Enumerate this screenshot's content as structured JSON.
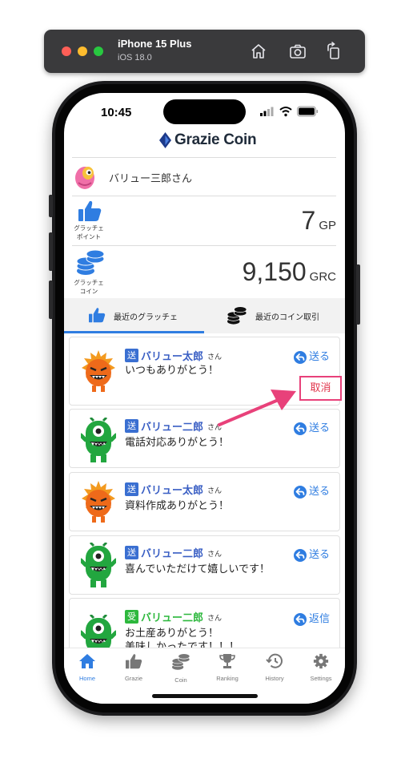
{
  "simulator": {
    "device": "iPhone 15 Plus",
    "os": "iOS 18.0",
    "icons": [
      "home-icon",
      "screenshot-icon",
      "rotate-icon"
    ]
  },
  "status_bar": {
    "time": "10:45"
  },
  "app": {
    "logo_text": "Grazie Coin"
  },
  "user": {
    "name": "バリュー三郎さん"
  },
  "points": {
    "gp_label_line1": "グラッチェ",
    "gp_label_line2": "ポイント",
    "gp_value": "7",
    "gp_unit": "GP",
    "coin_label_line1": "グラッチェ",
    "coin_label_line2": "コイン",
    "coin_value": "9,150",
    "coin_unit": "GRC"
  },
  "tabs": {
    "recent_grazie": "最近のグラッチェ",
    "recent_coin": "最近のコイン取引",
    "active": "recent_grazie"
  },
  "list": {
    "san": "さん",
    "items": [
      {
        "type_label": "送",
        "sender": "バリュー太郎",
        "message": "いつもありがとう！",
        "action": "送る"
      },
      {
        "type_label": "送",
        "sender": "バリュー二郎",
        "message": "電話対応ありがとう！",
        "action": "送る"
      },
      {
        "type_label": "送",
        "sender": "バリュー太郎",
        "message": "資料作成ありがとう！",
        "action": "送る"
      },
      {
        "type_label": "送",
        "sender": "バリュー二郎",
        "message": "喜んでいただけて嬉しいです！",
        "action": "送る"
      },
      {
        "type_label": "受",
        "sender": "バリュー二郎",
        "message_line1": "お土産ありがとう！",
        "message_line2": "美味しかったです！！！",
        "action": "返信"
      }
    ]
  },
  "annotation": {
    "cancel_label": "取消",
    "highlight_color": "#e8417a"
  },
  "tabbar": {
    "items": [
      {
        "label": "Home",
        "icon": "home-icon"
      },
      {
        "label": "Grazie",
        "icon": "thumbs-up-icon"
      },
      {
        "label": "Coin",
        "icon": "coins-icon"
      },
      {
        "label": "Ranking",
        "icon": "trophy-icon"
      },
      {
        "label": "History",
        "icon": "history-icon"
      },
      {
        "label": "Settings",
        "icon": "gear-icon"
      }
    ],
    "active": "Home"
  },
  "colors": {
    "accent": "#2f7de1",
    "send_badge": "#3a6fd1",
    "receive_badge": "#2db83d"
  }
}
